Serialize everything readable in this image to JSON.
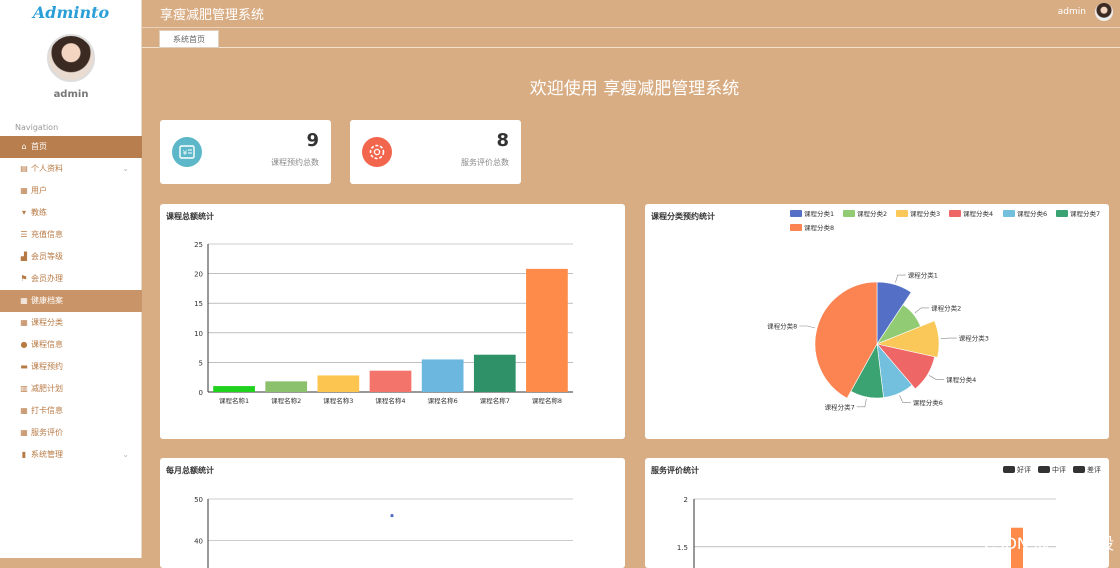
{
  "sidebar": {
    "logo": "Adminto",
    "username": "admin",
    "nav_label": "Navigation",
    "items": [
      {
        "label": "首页",
        "icon": "home-icon",
        "state": "active"
      },
      {
        "label": "个人资料",
        "icon": "profile-icon",
        "expandable": true
      },
      {
        "label": "用户",
        "icon": "grid-icon"
      },
      {
        "label": "教练",
        "icon": "coach-icon"
      },
      {
        "label": "充值信息",
        "icon": "list-icon"
      },
      {
        "label": "会员等级",
        "icon": "thumb-icon"
      },
      {
        "label": "会员办理",
        "icon": "flag-icon"
      },
      {
        "label": "健康档案",
        "icon": "grid-icon",
        "state": "hover"
      },
      {
        "label": "课程分类",
        "icon": "grid-icon"
      },
      {
        "label": "课程信息",
        "icon": "user-icon"
      },
      {
        "label": "课程预约",
        "icon": "monitor-icon"
      },
      {
        "label": "减肥计划",
        "icon": "bar-icon"
      },
      {
        "label": "打卡信息",
        "icon": "grid-icon"
      },
      {
        "label": "服务评价",
        "icon": "grid-icon"
      },
      {
        "label": "系统管理",
        "icon": "chart-icon",
        "expandable": true
      }
    ]
  },
  "header": {
    "title": "享瘦减肥管理系统",
    "user": "admin"
  },
  "tabs": [
    {
      "label": "系统首页"
    }
  ],
  "welcome": "欢迎使用 享瘦减肥管理系统",
  "stats": [
    {
      "value": "9",
      "label": "课程预约总数",
      "icon": "ticket-icon",
      "color": "#5cb8c9"
    },
    {
      "value": "8",
      "label": "服务评价总数",
      "icon": "gear-icon",
      "color": "#f2664e"
    }
  ],
  "cards": {
    "bar": "课程总额统计",
    "pie": "课程分类预约统计",
    "monthly": "每月总额统计",
    "eval": "服务评价统计"
  },
  "watermark": "CSDN @一点毕设",
  "chart_data": [
    {
      "type": "bar",
      "title": "课程总额统计",
      "categories": [
        "课程名称1",
        "课程名称2",
        "课程名称3",
        "课程名称4",
        "课程名称6",
        "课程名称7",
        "课程名称8"
      ],
      "values": [
        1,
        1.8,
        2.8,
        3.6,
        5.5,
        6.3,
        20.8
      ],
      "colors": [
        "#1ed21e",
        "#8bc16d",
        "#fcc54f",
        "#f2746a",
        "#6bb7df",
        "#2e9168",
        "#fe8b49"
      ],
      "ylim": [
        0,
        25
      ],
      "yticks": [
        0,
        5,
        10,
        15,
        20,
        25
      ],
      "grid": true
    },
    {
      "type": "pie",
      "title": "课程分类预约统计",
      "legend_position": "top",
      "categories": [
        "课程分类1",
        "课程分类2",
        "课程分类3",
        "课程分类4",
        "课程分类6",
        "课程分类7",
        "课程分类8"
      ],
      "legend": [
        "课程分类1",
        "课程分类2",
        "课程分类3",
        "课程分类4",
        "课程分类6",
        "课程分类7",
        "课程分类8"
      ],
      "values": [
        9.3,
        9.6,
        9.6,
        10.3,
        9.3,
        10.0,
        42.0
      ],
      "colors": [
        "#5470c6",
        "#91cc75",
        "#fac858",
        "#ee6666",
        "#73c0de",
        "#3ba272",
        "#fc8452"
      ],
      "outer_radius": [
        62,
        47,
        62,
        59,
        54,
        54,
        62
      ]
    },
    {
      "type": "line",
      "title": "每月总额统计",
      "ylim": [
        30,
        50
      ],
      "yticks": [
        40,
        50
      ],
      "points": [
        {
          "y": 46
        }
      ]
    },
    {
      "type": "bar",
      "title": "服务评价统计",
      "legend_position": "top-right",
      "series": [
        {
          "name": "好评"
        },
        {
          "name": "中评"
        },
        {
          "name": "差评"
        }
      ],
      "legend_color": "#333333",
      "ylim": [
        1.3,
        2
      ],
      "yticks": [
        1.5,
        2
      ],
      "bars": [
        {
          "value": 1.7,
          "color": "#fe8b49"
        }
      ]
    }
  ]
}
